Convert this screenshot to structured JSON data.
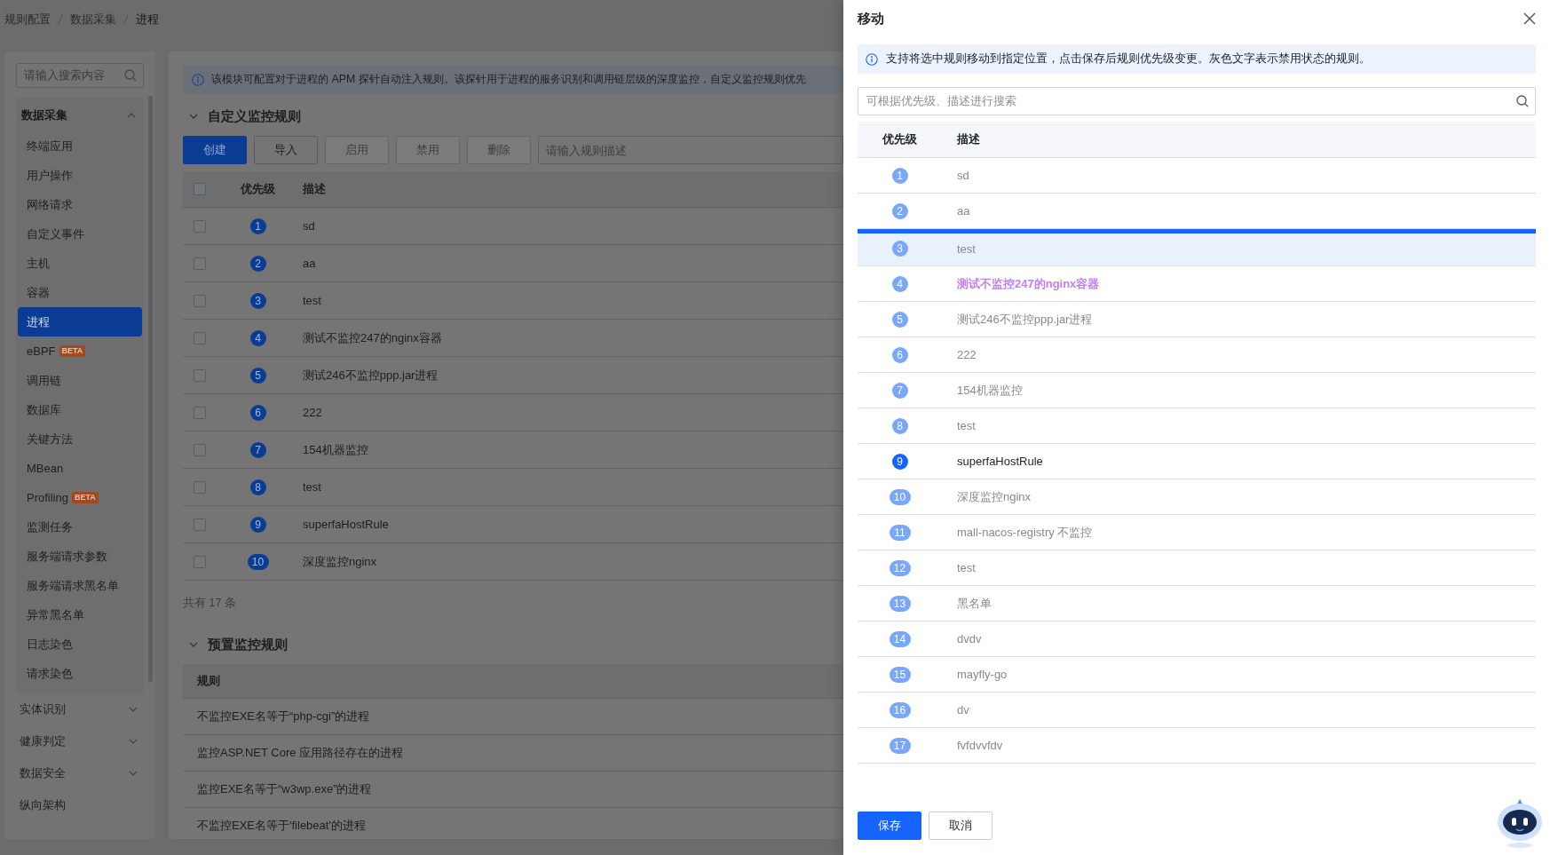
{
  "breadcrumb": [
    {
      "label": "规则配置",
      "current": false
    },
    {
      "label": "数据采集",
      "current": false
    },
    {
      "label": "进程",
      "current": true
    }
  ],
  "sidebar": {
    "search": {
      "placeholder": "请输入搜索内容"
    },
    "groups": [
      {
        "kind": "group",
        "label": "数据采集",
        "expanded": true,
        "items": [
          {
            "label": "终端应用",
            "selected": false
          },
          {
            "label": "用户操作",
            "selected": false
          },
          {
            "label": "网络请求",
            "selected": false
          },
          {
            "label": "自定义事件",
            "selected": false
          },
          {
            "label": "主机",
            "selected": false
          },
          {
            "label": "容器",
            "selected": false
          },
          {
            "label": "进程",
            "selected": true
          },
          {
            "label": "eBPF",
            "selected": false,
            "badge": "BETA"
          },
          {
            "label": "调用链",
            "selected": false
          },
          {
            "label": "数据库",
            "selected": false
          },
          {
            "label": "关键方法",
            "selected": false
          },
          {
            "label": "MBean",
            "selected": false
          },
          {
            "label": "Profiling",
            "selected": false,
            "badge": "BETA"
          },
          {
            "label": "监测任务",
            "selected": false
          },
          {
            "label": "服务端请求参数",
            "selected": false
          },
          {
            "label": "服务端请求黑名单",
            "selected": false
          },
          {
            "label": "异常黑名单",
            "selected": false
          },
          {
            "label": "日志染色",
            "selected": false
          },
          {
            "label": "请求染色",
            "selected": false
          }
        ]
      },
      {
        "kind": "group",
        "label": "实体识别",
        "expanded": false
      },
      {
        "kind": "group",
        "label": "健康判定",
        "expanded": false
      },
      {
        "kind": "group",
        "label": "数据安全",
        "expanded": false
      },
      {
        "kind": "link",
        "label": "纵向架构"
      }
    ]
  },
  "main": {
    "notice": "该模块可配置对于进程的 APM 探针自动注入规则。该探针用于进程的服务识别和调用链层级的深度监控，自定义监控规则优先",
    "custom_rules": {
      "title": "自定义监控规则",
      "expanded": true,
      "buttons": [
        {
          "label": "创建",
          "kind": "primary",
          "disabled": false
        },
        {
          "label": "导入",
          "kind": "default",
          "disabled": false
        },
        {
          "label": "启用",
          "kind": "default",
          "disabled": true
        },
        {
          "label": "禁用",
          "kind": "default",
          "disabled": true
        },
        {
          "label": "删除",
          "kind": "default",
          "disabled": true
        }
      ],
      "search": {
        "placeholder": "请输入规则描述"
      },
      "select_all_checked": false,
      "columns": [
        "优先级",
        "描述"
      ],
      "rows": [
        {
          "priority": "1",
          "description": "sd",
          "checked": false
        },
        {
          "priority": "2",
          "description": "aa",
          "checked": false
        },
        {
          "priority": "3",
          "description": "test",
          "checked": false
        },
        {
          "priority": "4",
          "description": "测试不监控247的nginx容器",
          "checked": false
        },
        {
          "priority": "5",
          "description": "测试246不监控ppp.jar进程",
          "checked": false
        },
        {
          "priority": "6",
          "description": "222",
          "checked": false
        },
        {
          "priority": "7",
          "description": "154机器监控",
          "checked": false
        },
        {
          "priority": "8",
          "description": "test",
          "checked": false
        },
        {
          "priority": "9",
          "description": "superfaHostRule",
          "checked": false
        },
        {
          "priority": "10",
          "description": "深度监控nginx",
          "checked": false
        }
      ],
      "total": "共有 17 条"
    },
    "preset_rules": {
      "title": "预置监控规则",
      "expanded": true,
      "columns": [
        "规则"
      ],
      "rows": [
        "不监控EXE名等于“php-cgi”的进程",
        "监控ASP.NET Core 应用路径存在的进程",
        "监控EXE名等于“w3wp.exe”的进程",
        "不监控EXE名等于'filebeat'的进程"
      ]
    }
  },
  "drawer": {
    "title": "移动",
    "notice": "支持将选中规则移动到指定位置，点击保存后规则优先级变更。灰色文字表示禁用状态的规则。",
    "search": {
      "placeholder": "可根据优先级、描述进行搜索"
    },
    "columns": [
      "优先级",
      "描述"
    ],
    "rows": [
      {
        "priority": "1",
        "description": "sd",
        "disabled": true,
        "moving": false,
        "drop_target": false
      },
      {
        "priority": "2",
        "description": "aa",
        "disabled": true,
        "moving": false,
        "drop_target": false
      },
      {
        "priority": "3",
        "description": "test",
        "disabled": true,
        "moving": false,
        "drop_target": true
      },
      {
        "priority": "4",
        "description": "测试不监控247的nginx容器",
        "disabled": true,
        "moving": true,
        "drop_target": false
      },
      {
        "priority": "5",
        "description": "测试246不监控ppp.jar进程",
        "disabled": true,
        "moving": false,
        "drop_target": false
      },
      {
        "priority": "6",
        "description": "222",
        "disabled": true,
        "moving": false,
        "drop_target": false
      },
      {
        "priority": "7",
        "description": "154机器监控",
        "disabled": true,
        "moving": false,
        "drop_target": false
      },
      {
        "priority": "8",
        "description": "test",
        "disabled": true,
        "moving": false,
        "drop_target": false
      },
      {
        "priority": "9",
        "description": "superfaHostRule",
        "disabled": false,
        "moving": false,
        "drop_target": false
      },
      {
        "priority": "10",
        "description": "深度监控nginx",
        "disabled": true,
        "moving": false,
        "drop_target": false
      },
      {
        "priority": "11",
        "description": "mall-nacos-registry 不监控",
        "disabled": true,
        "moving": false,
        "drop_target": false
      },
      {
        "priority": "12",
        "description": "test",
        "disabled": true,
        "moving": false,
        "drop_target": false
      },
      {
        "priority": "13",
        "description": "黑名单",
        "disabled": true,
        "moving": false,
        "drop_target": false
      },
      {
        "priority": "14",
        "description": "dvdv",
        "disabled": true,
        "moving": false,
        "drop_target": false
      },
      {
        "priority": "15",
        "description": "mayfly-go",
        "disabled": true,
        "moving": false,
        "drop_target": false
      },
      {
        "priority": "16",
        "description": "dv",
        "disabled": true,
        "moving": false,
        "drop_target": false
      },
      {
        "priority": "17",
        "description": "fvfdvvfdv",
        "disabled": true,
        "moving": false,
        "drop_target": false
      }
    ],
    "buttons": [
      {
        "label": "保存",
        "kind": "primary"
      },
      {
        "label": "取消",
        "kind": "default"
      }
    ]
  }
}
